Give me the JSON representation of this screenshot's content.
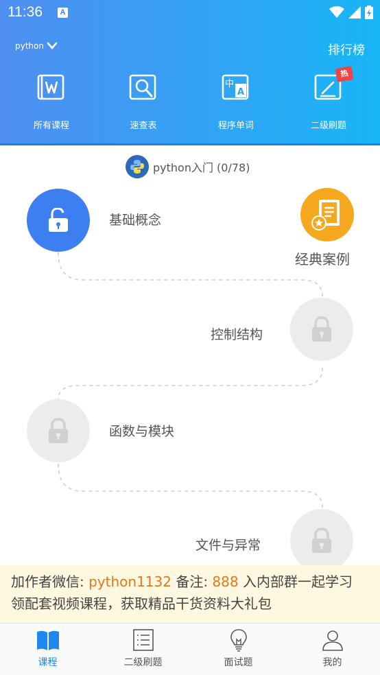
{
  "status_bar": {
    "time": "11:36"
  },
  "header": {
    "language": "python",
    "rank_label": "排行榜",
    "quick_nav": [
      {
        "label": "所有课程",
        "icon": "book-w-icon"
      },
      {
        "label": "速查表",
        "icon": "search-doc-icon"
      },
      {
        "label": "程序单词",
        "icon": "dictionary-icon"
      },
      {
        "label": "二级刷题",
        "icon": "edit-exam-icon",
        "badge": "热"
      }
    ]
  },
  "course": {
    "title": "python入门 (0/78)"
  },
  "path": {
    "nodes": [
      {
        "label": "基础概念",
        "state": "unlocked"
      },
      {
        "label": "控制结构",
        "state": "locked"
      },
      {
        "label": "函数与模块",
        "state": "locked"
      },
      {
        "label": "文件与异常",
        "state": "locked"
      }
    ],
    "case": {
      "label": "经典案例"
    }
  },
  "promo": {
    "prefix": "加作者微信: ",
    "wechat": "python1132",
    "note_label": "  备注: ",
    "note_value": "888",
    "suffix": " 入内部群一起学习",
    "line2": "领配套视频课程，获取精品干货资料大礼包"
  },
  "bottom_nav": [
    {
      "label": "课程",
      "icon": "book-open-icon",
      "active": true
    },
    {
      "label": "二级刷题",
      "icon": "list-icon",
      "active": false
    },
    {
      "label": "面试题",
      "icon": "bulb-icon",
      "active": false
    },
    {
      "label": "我的",
      "icon": "user-icon",
      "active": false
    }
  ],
  "colors": {
    "primary": "#3d7ff0",
    "accent": "#e0791e",
    "locked": "#ececec",
    "case": "#f4a81e"
  }
}
